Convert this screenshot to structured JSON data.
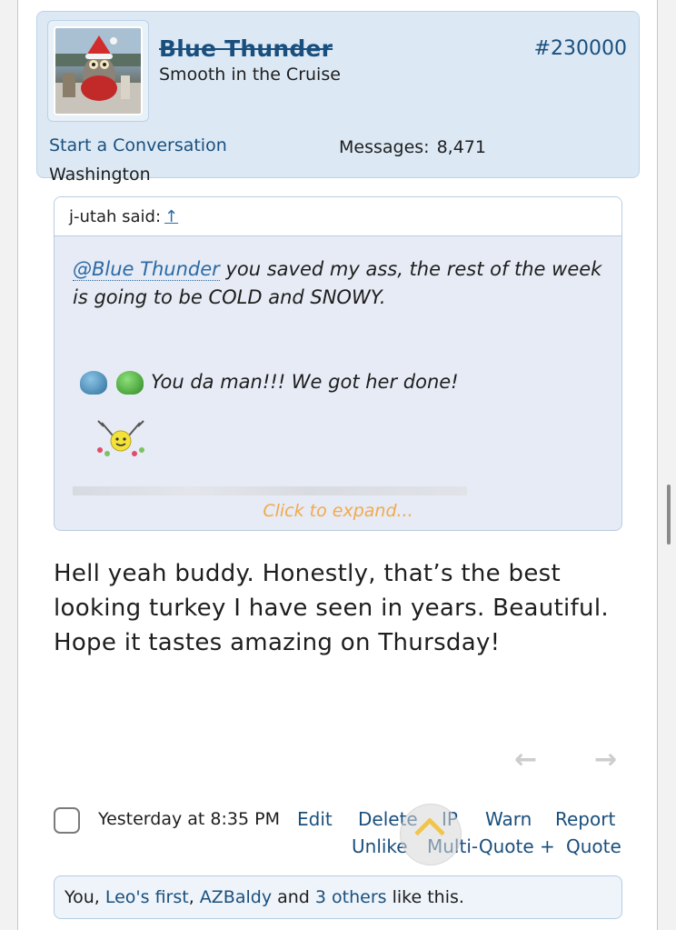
{
  "post_header": {
    "username": "Blue Thunder",
    "user_title": "Smooth in the Cruise",
    "post_number": "#230000",
    "start_conversation": "Start a Conversation",
    "messages_label": "Messages:",
    "messages_value": "8,471",
    "location": "Washington"
  },
  "quote": {
    "author_label": "j-utah said:",
    "jump_icon": "↑",
    "mention": "@Blue Thunder",
    "text": " you saved my ass, the rest of the week is going to be COLD and SNOWY.",
    "smilies_text": "You da man!!! We got her done!",
    "expand_label": "Click to expand..."
  },
  "message": {
    "text": "Hell yeah buddy. Honestly, that’s the best looking turkey I have seen in years. Beautiful. Hope it tastes amazing on Thursday!"
  },
  "actions": {
    "timestamp": "Yesterday at 8:35 PM",
    "edit": "Edit",
    "delete": "Delete",
    "ip": "IP",
    "warn": "Warn",
    "report": "Report",
    "unlike": "Unlike",
    "multi_quote": "Multi-Quote +",
    "quote": "Quote"
  },
  "likes": {
    "prefix": "You,",
    "user1": "Leo's first",
    "sep": ",",
    "user2": "AZBaldy",
    "and": "and",
    "others": "3 others",
    "suffix": "like this."
  },
  "icons": {
    "prev": "arrow-left-icon",
    "next": "arrow-right-icon",
    "scroll_top": "chevron-up-icon"
  },
  "colors": {
    "link": "#1a4f7d",
    "card_bg": "#dce9f5",
    "expand": "#f3a94a"
  }
}
